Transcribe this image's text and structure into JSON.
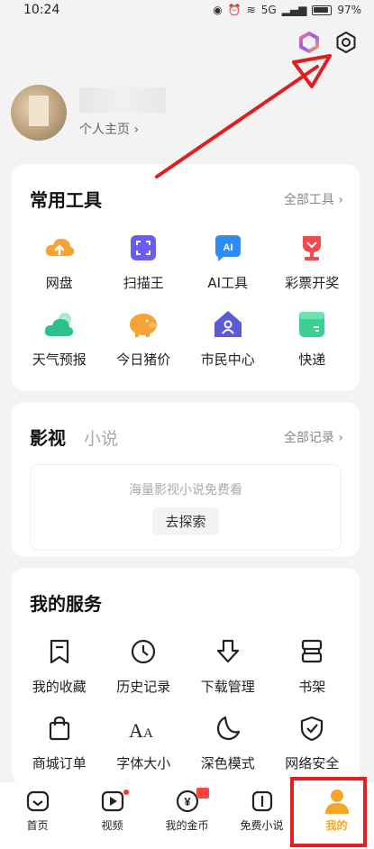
{
  "status_bar": {
    "time": "10:24",
    "battery": "97%",
    "signal": "5G"
  },
  "profile": {
    "link": "个人主页 ›"
  },
  "tools": {
    "title": "常用工具",
    "more": "全部工具 ›",
    "items": [
      {
        "label": "网盘",
        "icon": "cloud-upload-icon"
      },
      {
        "label": "扫描王",
        "icon": "scan-icon"
      },
      {
        "label": "AI工具",
        "icon": "ai-chat-icon"
      },
      {
        "label": "彩票开奖",
        "icon": "trophy-icon"
      },
      {
        "label": "天气预报",
        "icon": "weather-icon"
      },
      {
        "label": "今日猪价",
        "icon": "piggy-bank-icon"
      },
      {
        "label": "市民中心",
        "icon": "house-person-icon"
      },
      {
        "label": "快递",
        "icon": "package-icon"
      }
    ]
  },
  "media": {
    "tab_active": "影视",
    "tab_inactive": "小说",
    "more": "全部记录 ›",
    "empty_text": "海量影视小说免费看",
    "explore_button": "去探索"
  },
  "services": {
    "title": "我的服务",
    "items": [
      {
        "label": "我的收藏",
        "icon": "bookmark-icon"
      },
      {
        "label": "历史记录",
        "icon": "clock-icon"
      },
      {
        "label": "下载管理",
        "icon": "download-icon"
      },
      {
        "label": "书架",
        "icon": "bookshelf-icon"
      },
      {
        "label": "商城订单",
        "icon": "shopping-bag-icon"
      },
      {
        "label": "字体大小",
        "icon": "font-size-icon"
      },
      {
        "label": "深色模式",
        "icon": "moon-icon"
      },
      {
        "label": "网络安全",
        "icon": "shield-check-icon"
      }
    ]
  },
  "bottom_nav": {
    "items": [
      {
        "label": "首页",
        "icon": "home-icon"
      },
      {
        "label": "视频",
        "icon": "video-icon"
      },
      {
        "label": "我的金币",
        "icon": "coin-icon"
      },
      {
        "label": "免费小说",
        "icon": "book-icon"
      },
      {
        "label": "我的",
        "icon": "person-icon"
      }
    ],
    "active_index": 4
  },
  "colors": {
    "accent": "#f5a623",
    "annotation": "#e02020",
    "background": "#f3f3f3"
  }
}
